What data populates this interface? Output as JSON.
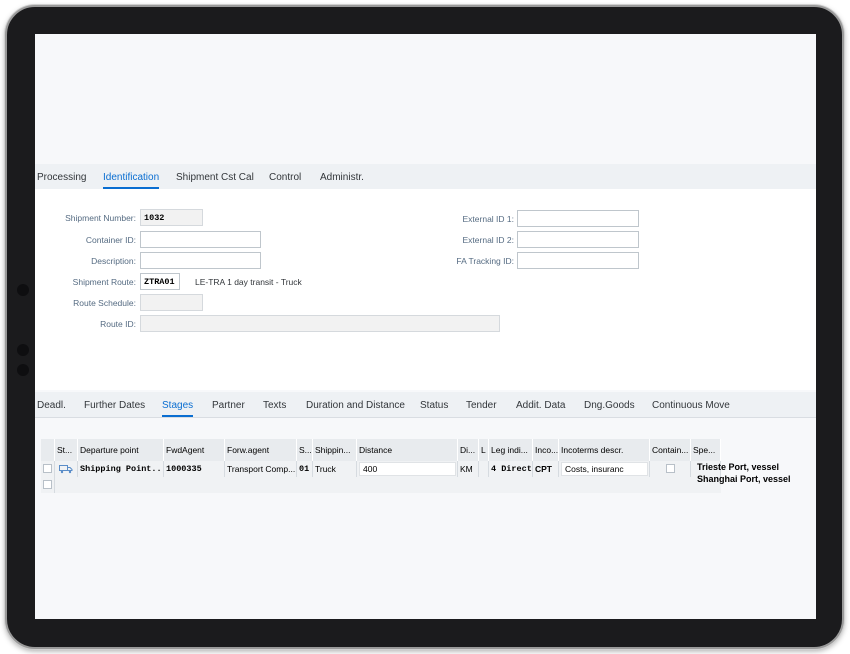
{
  "top_tabs": [
    {
      "label": "Processing",
      "active": false
    },
    {
      "label": "Identification",
      "active": true
    },
    {
      "label": "Shipment Cst Cal",
      "active": false
    },
    {
      "label": "Control",
      "active": false
    },
    {
      "label": "Administr.",
      "active": false
    }
  ],
  "form": {
    "shipment_number_label": "Shipment Number:",
    "shipment_number_value": "1032",
    "container_id_label": "Container ID:",
    "container_id_value": "",
    "description_label": "Description:",
    "description_value": "",
    "shipment_route_label": "Shipment Route:",
    "shipment_route_value": "ZTRA01",
    "shipment_route_desc": "LE-TRA 1 day transit - Truck",
    "route_schedule_label": "Route Schedule:",
    "route_schedule_value": "",
    "route_id_label": "Route ID:",
    "route_id_value": "",
    "external_id1_label": "External ID 1:",
    "external_id1_value": "",
    "external_id2_label": "External ID 2:",
    "external_id2_value": "",
    "fa_tracking_label": "FA Tracking ID:",
    "fa_tracking_value": ""
  },
  "bottom_tabs": [
    {
      "label": "Deadl.",
      "active": false
    },
    {
      "label": "Further Dates",
      "active": false
    },
    {
      "label": "Stages",
      "active": true
    },
    {
      "label": "Partner",
      "active": false
    },
    {
      "label": "Texts",
      "active": false
    },
    {
      "label": "Duration and Distance",
      "active": false
    },
    {
      "label": "Status",
      "active": false
    },
    {
      "label": "Tender",
      "active": false
    },
    {
      "label": "Addit. Data",
      "active": false
    },
    {
      "label": "Dng.Goods",
      "active": false
    },
    {
      "label": "Continuous Move",
      "active": false
    }
  ],
  "grid": {
    "headers": [
      "St...",
      "Departure point",
      "FwdAgent",
      "Forw.agent",
      "S...",
      "Shippin...",
      "Distance",
      "Di...",
      "L",
      "Leg indi...",
      "Inco...",
      "Incoterms descr.",
      "Contain...",
      "Spe..."
    ],
    "row1": {
      "departure_point": "Shipping Point...",
      "fwd_agent": "1000335",
      "forw_agent_name": "Transport Comp...",
      "s": "01",
      "shipping_type": "Truck",
      "distance": "400",
      "distance_unit": "KM",
      "leg_indicator": "4 Direct...",
      "incoterms": "CPT",
      "incoterms_descr": "Costs, insuranc"
    }
  },
  "side_notes": {
    "line1": "Trieste Port, vessel",
    "line2": "Shanghai Port, vessel"
  },
  "colors": {
    "accent": "#0a6ed1",
    "tabbar_bg": "#eef1f4",
    "frame": "#1b1b1d"
  }
}
